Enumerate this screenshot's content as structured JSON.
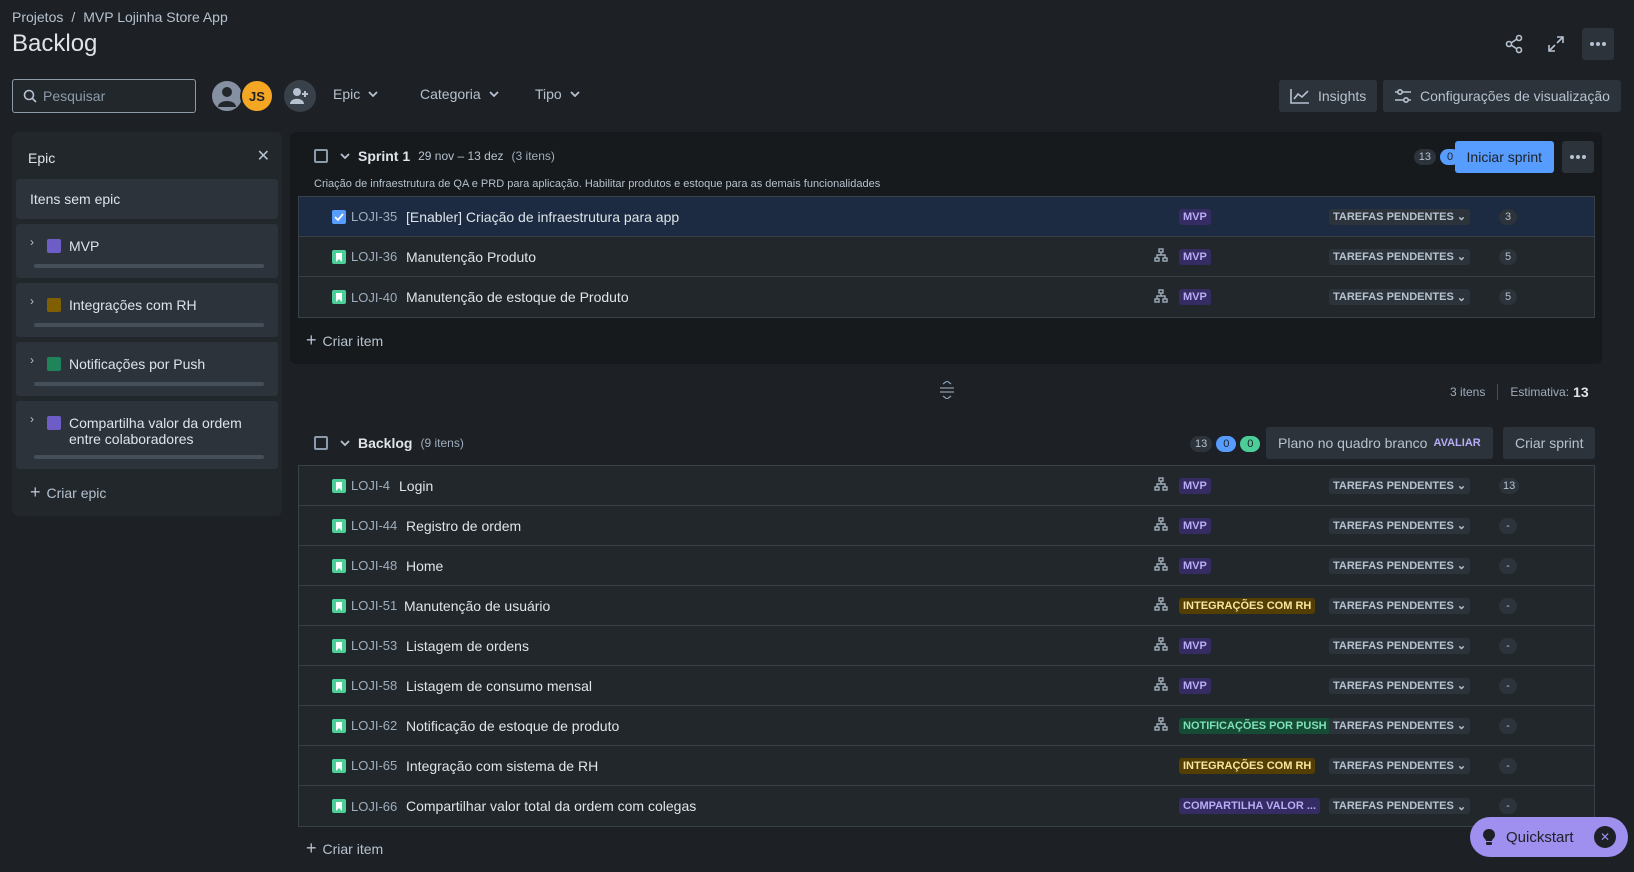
{
  "breadcrumb": {
    "root": "Projetos",
    "sep": "/",
    "project": "MVP Lojinha Store App"
  },
  "page_title": "Backlog",
  "toolbar": {
    "search_placeholder": "Pesquisar",
    "avatar_initials": "JS",
    "filters": [
      "Epic",
      "Categoria",
      "Tipo"
    ],
    "insights": "Insights",
    "view_settings": "Configurações de visualização"
  },
  "epic_panel": {
    "title": "Epic",
    "no_epic": "Itens sem epic",
    "epics": [
      {
        "name": "MVP",
        "color": "#6e5dc6"
      },
      {
        "name": "Integrações com RH",
        "color": "#7f5f01"
      },
      {
        "name": "Notificações por Push",
        "color": "#1f845a"
      },
      {
        "name": "Compartilha valor da ordem entre colaboradores",
        "color": "#6e5dc6"
      }
    ],
    "create": "Criar epic"
  },
  "sprint": {
    "title": "Sprint 1",
    "dates": "29 nov – 13 dez",
    "count": "(3 itens)",
    "goal": "Criação de infraestrutura de QA e PRD para aplicação. Habilitar produtos e estoque para as demais funcionalidades",
    "points": {
      "todo": "13",
      "progress": "0",
      "done": "0"
    },
    "start_button": "Iniciar sprint",
    "create_item": "Criar item",
    "items": [
      {
        "key": "LOJI-35",
        "summary": "[Enabler] Criação de infraestrutura para app",
        "epic": "MVP",
        "epic_style": "purple",
        "status": "TAREFAS PENDENTES",
        "estimate": "3",
        "child": false,
        "selected": true
      },
      {
        "key": "LOJI-36",
        "summary": "Manutenção Produto",
        "epic": "MVP",
        "epic_style": "purple",
        "status": "TAREFAS PENDENTES",
        "estimate": "5",
        "child": true,
        "selected": false
      },
      {
        "key": "LOJI-40",
        "summary": "Manutenção de estoque de Produto",
        "epic": "MVP",
        "epic_style": "purple",
        "status": "TAREFAS PENDENTES",
        "estimate": "5",
        "child": true,
        "selected": false
      }
    ]
  },
  "summary_bar": {
    "items": "3 itens",
    "estimate_label": "Estimativa:",
    "estimate_value": "13"
  },
  "backlog": {
    "title": "Backlog",
    "count": "(9 itens)",
    "points": {
      "todo": "13",
      "progress": "0",
      "done": "0"
    },
    "whiteboard": "Plano no quadro branco",
    "whiteboard_badge": "AVALIAR",
    "create_sprint": "Criar sprint",
    "create_item": "Criar item",
    "items": [
      {
        "key": "LOJI-4",
        "summary": "Login",
        "epic": "MVP",
        "epic_style": "purple",
        "status": "TAREFAS PENDENTES",
        "estimate": "13",
        "child": true
      },
      {
        "key": "LOJI-44",
        "summary": "Registro de ordem",
        "epic": "MVP",
        "epic_style": "purple",
        "status": "TAREFAS PENDENTES",
        "estimate": "-",
        "child": true
      },
      {
        "key": "LOJI-48",
        "summary": "Home",
        "epic": "MVP",
        "epic_style": "purple",
        "status": "TAREFAS PENDENTES",
        "estimate": "-",
        "child": true
      },
      {
        "key": "LOJI-51",
        "summary": "Manutenção de usuário",
        "epic": "INTEGRAÇÕES COM RH",
        "epic_style": "orange",
        "status": "TAREFAS PENDENTES",
        "estimate": "-",
        "child": true
      },
      {
        "key": "LOJI-53",
        "summary": "Listagem de ordens",
        "epic": "MVP",
        "epic_style": "purple",
        "status": "TAREFAS PENDENTES",
        "estimate": "-",
        "child": true
      },
      {
        "key": "LOJI-58",
        "summary": "Listagem de consumo mensal",
        "epic": "MVP",
        "epic_style": "purple",
        "status": "TAREFAS PENDENTES",
        "estimate": "-",
        "child": true
      },
      {
        "key": "LOJI-62",
        "summary": "Notificação de estoque de produto",
        "epic": "NOTIFICAÇÕES POR PUSH",
        "epic_style": "green",
        "status": "TAREFAS PENDENTES",
        "estimate": "-",
        "child": true
      },
      {
        "key": "LOJI-65",
        "summary": "Integração com sistema de RH",
        "epic": "INTEGRAÇÕES COM RH",
        "epic_style": "orange",
        "status": "TAREFAS PENDENTES",
        "estimate": "-",
        "child": false
      },
      {
        "key": "LOJI-66",
        "summary": "Compartilhar valor total da ordem com colegas",
        "epic": "COMPARTILHA VALOR ...",
        "epic_style": "purple",
        "status": "TAREFAS PENDENTES",
        "estimate": "-",
        "child": false
      }
    ]
  },
  "quickstart": "Quickstart"
}
